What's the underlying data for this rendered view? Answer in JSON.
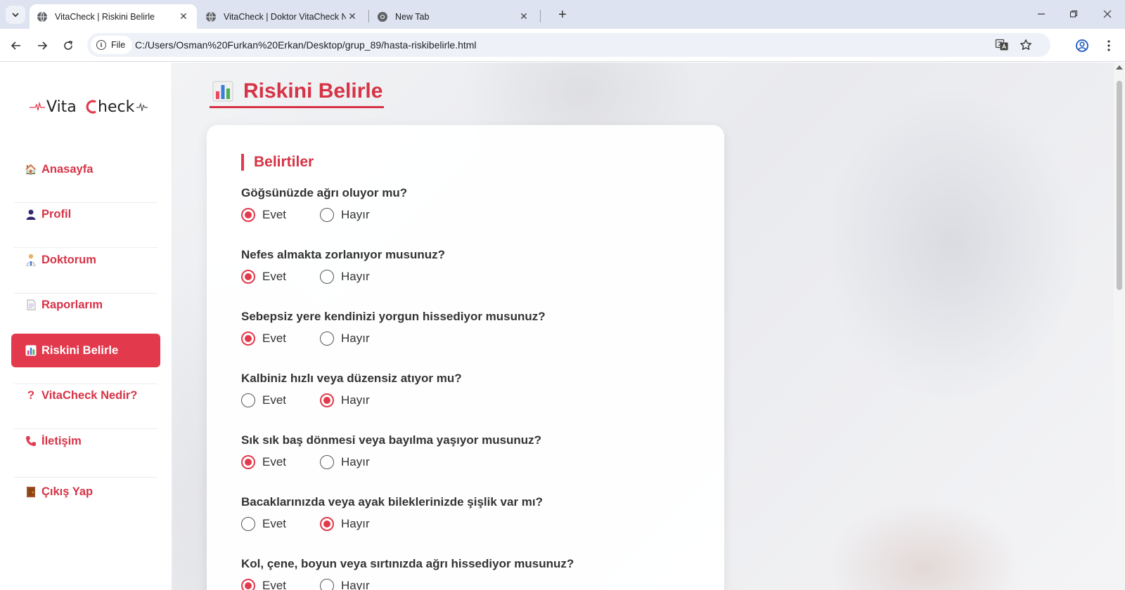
{
  "browser": {
    "tabs": [
      {
        "title": "VitaCheck | Riskini Belirle",
        "active": true
      },
      {
        "title": "VitaCheck | Doktor VitaCheck N",
        "active": false
      },
      {
        "title": "New Tab",
        "active": false
      }
    ],
    "chip_label": "File",
    "url": "C:/Users/Osman%20Furkan%20Erkan/Desktop/grup_89/hasta-riskibelirle.html"
  },
  "sidebar": {
    "logo_text": "VitaCheck",
    "items": [
      {
        "label": "Anasayfa",
        "icon": "house-icon",
        "active": false
      },
      {
        "label": "Profil",
        "icon": "user-icon",
        "active": false
      },
      {
        "label": "Doktorum",
        "icon": "doctor-icon",
        "active": false
      },
      {
        "label": "Raporlarım",
        "icon": "document-icon",
        "active": false
      },
      {
        "label": "Riskini Belirle",
        "icon": "bar-chart-icon",
        "active": true
      },
      {
        "label": "VitaCheck Nedir?",
        "icon": "question-icon",
        "active": false
      },
      {
        "label": "İletişim",
        "icon": "phone-icon",
        "active": false
      },
      {
        "label": "Çıkış Yap",
        "icon": "door-icon",
        "active": false
      }
    ]
  },
  "main": {
    "page_title": "Riskini Belirle",
    "section_title": "Belirtiler",
    "yes_label": "Evet",
    "no_label": "Hayır",
    "questions": [
      {
        "text": "Göğsünüzde ağrı oluyor mu?",
        "answer": "Evet"
      },
      {
        "text": "Nefes almakta zorlanıyor musunuz?",
        "answer": "Evet"
      },
      {
        "text": "Sebepsiz yere kendinizi yorgun hissediyor musunuz?",
        "answer": "Evet"
      },
      {
        "text": "Kalbiniz hızlı veya düzensiz atıyor mu?",
        "answer": "Hayır"
      },
      {
        "text": "Sık sık baş dönmesi veya bayılma yaşıyor musunuz?",
        "answer": "Evet"
      },
      {
        "text": "Bacaklarınızda veya ayak bileklerinizde şişlik var mı?",
        "answer": "Hayır"
      },
      {
        "text": "Kol, çene, boyun veya sırtınızda ağrı hissediyor musunuz?",
        "answer": "Evet"
      }
    ]
  },
  "colors": {
    "accent": "#e23a4c",
    "accent_text": "#d63346",
    "tabbar": "#dde3f0"
  }
}
